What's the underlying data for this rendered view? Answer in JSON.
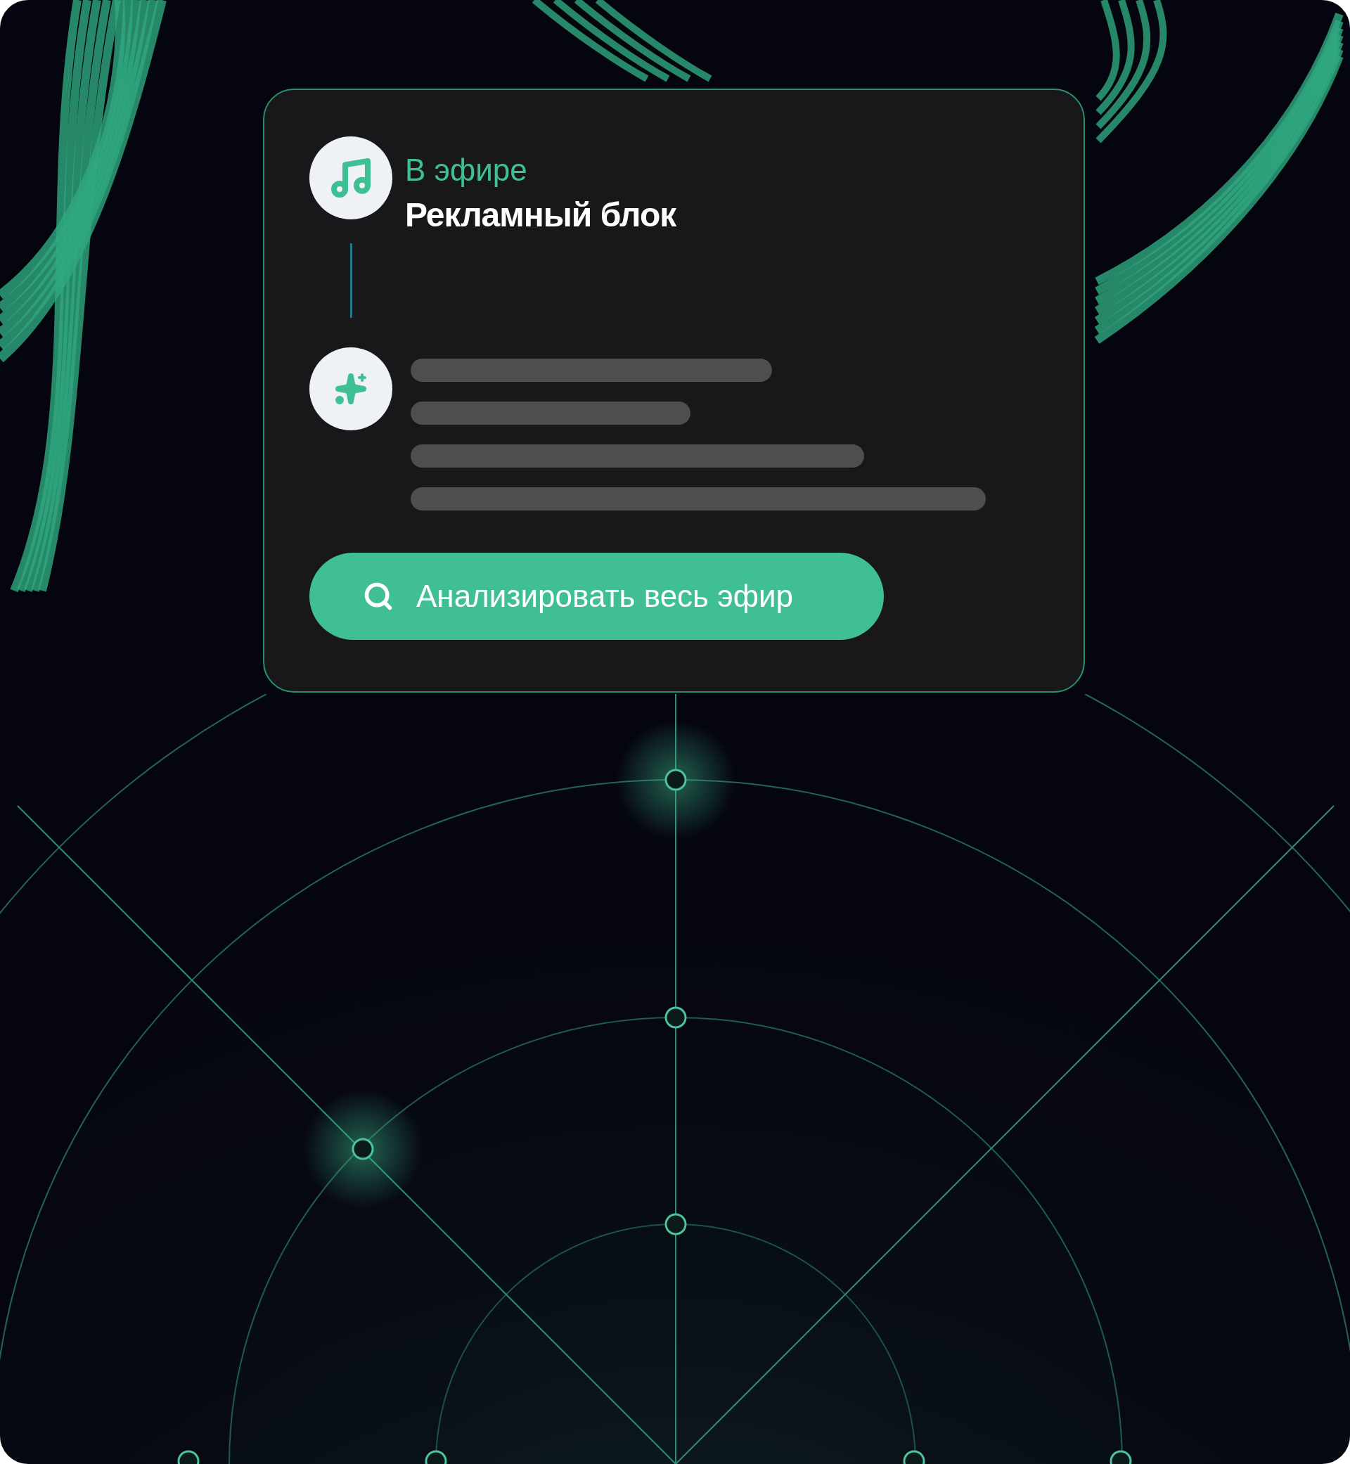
{
  "card": {
    "status": "В эфире",
    "title": "Рекламный блок",
    "button": {
      "label": "Анализировать весь эфир"
    }
  }
}
